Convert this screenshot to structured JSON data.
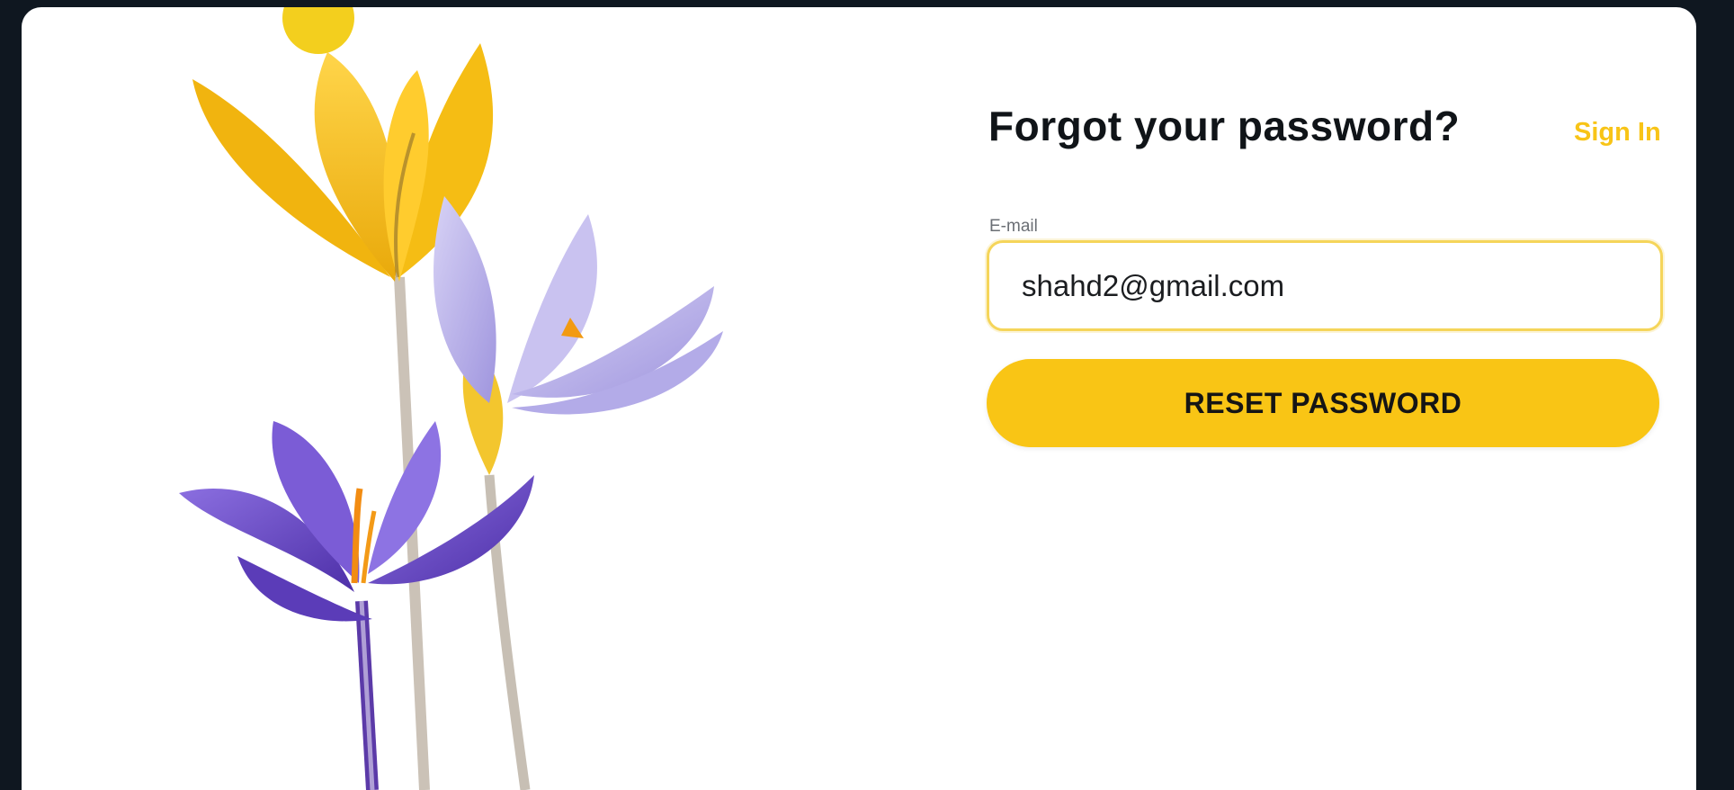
{
  "form": {
    "title": "Forgot your password?",
    "signin_link": "Sign In",
    "email_label": "E-mail",
    "email_value": "shahd2@gmail.com",
    "email_type": "email",
    "reset_button": "RESET PASSWORD"
  },
  "illustration": {
    "subject": "crocus-flowers",
    "colors": {
      "yellow_petal": "#f5b80f",
      "lilac_petal": "#b9b2ea",
      "violet_petal": "#6d4cc7",
      "stamen": "#f38b12",
      "stem": "#c9c0b5"
    }
  },
  "theme": {
    "accent": "#f9c515",
    "background": "#ffffff",
    "outer": "#0f1720",
    "text": "#101418"
  }
}
